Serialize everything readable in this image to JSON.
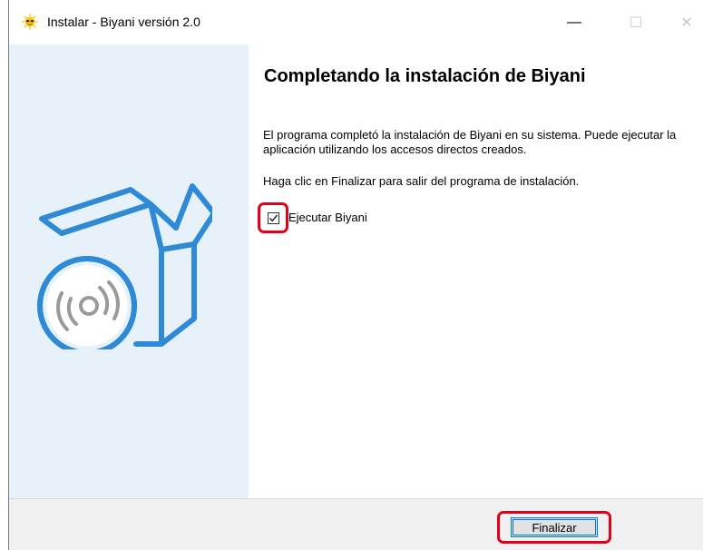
{
  "window": {
    "title": "Instalar - Biyani versión 2.0",
    "controls": {
      "minimize": "—",
      "maximize": "☐",
      "close": "✕"
    }
  },
  "side_panel": {
    "illustration": "box-with-disc-icon"
  },
  "content": {
    "heading": "Completando la instalación de Biyani",
    "paragraph1": "El programa completó la instalación de Biyani en su sistema. Puede ejecutar la aplicación utilizando los accesos directos creados.",
    "paragraph2": "Haga clic en Finalizar para salir del programa de instalación.",
    "run_checkbox": {
      "label": "Ejecutar Biyani",
      "checked": true
    }
  },
  "footer": {
    "finish_button": "Finalizar"
  },
  "colors": {
    "highlight": "#e0001a",
    "side_panel": "#e7f1fa",
    "icon_blue": "#2e8ad6"
  }
}
